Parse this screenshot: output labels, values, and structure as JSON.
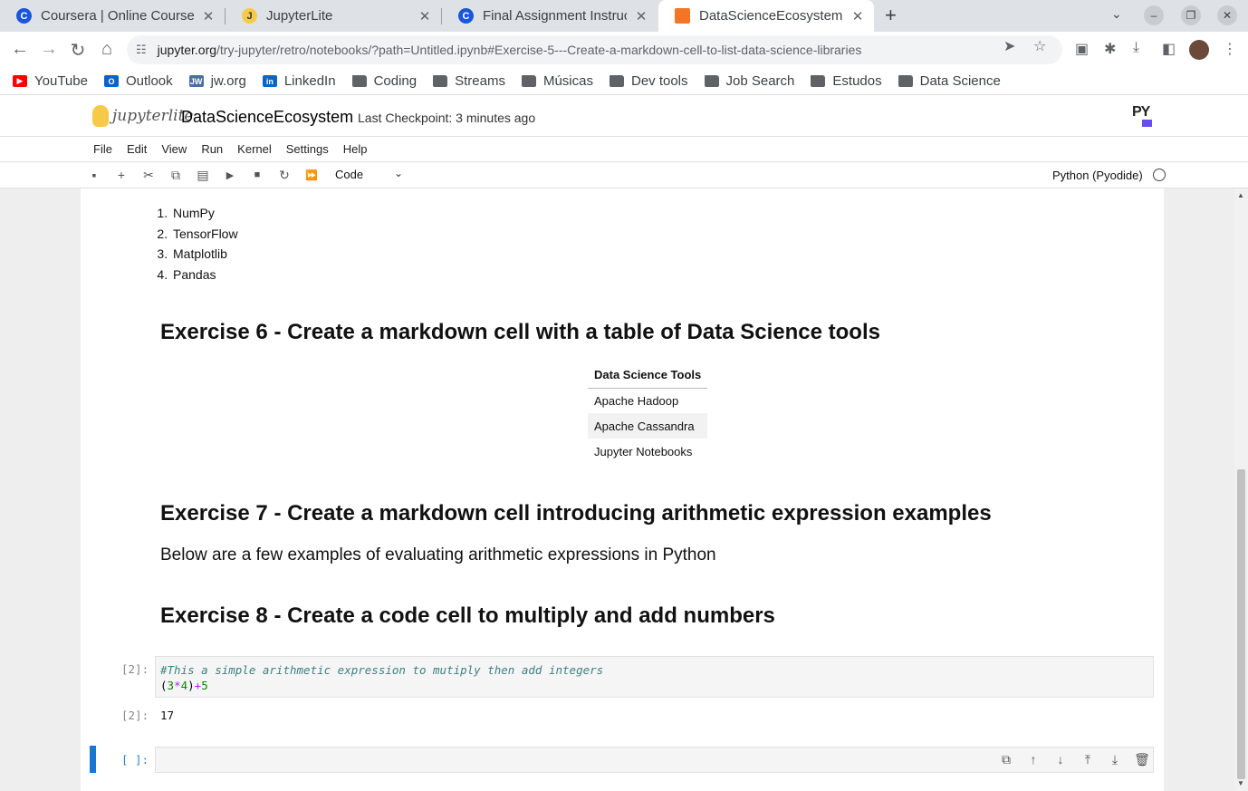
{
  "browser": {
    "tabs": [
      {
        "title": "Coursera | Online Courses",
        "favicon": "coursera-icon",
        "close": "✕"
      },
      {
        "title": "JupyterLite",
        "favicon": "jupyterlite-icon",
        "close": "✕"
      },
      {
        "title": "Final Assignment Instructi",
        "favicon": "coursera-icon",
        "close": "✕"
      },
      {
        "title": "DataScienceEcosystem",
        "favicon": "notebook-icon",
        "close": "✕"
      }
    ],
    "url_domain": "jupyter.org",
    "url_path": "/try-jupyter/retro/notebooks/?path=Untitled.ipynb#Exercise-5---Create-a-markdown-cell-to-list-data-science-libraries",
    "bookmarks": [
      {
        "label": "YouTube",
        "icon": "youtube-icon",
        "color": "#ff0000"
      },
      {
        "label": "Outlook",
        "icon": "outlook-icon",
        "color": "#0a64c8"
      },
      {
        "label": "jw.org",
        "icon": "jw-icon",
        "color": "#4a6da7"
      },
      {
        "label": "LinkedIn",
        "icon": "linkedin-icon",
        "color": "#0a66c2"
      },
      {
        "label": "Coding",
        "icon": "folder-icon"
      },
      {
        "label": "Streams",
        "icon": "folder-icon"
      },
      {
        "label": "Músicas",
        "icon": "folder-icon"
      },
      {
        "label": "Dev tools",
        "icon": "folder-icon"
      },
      {
        "label": "Job Search",
        "icon": "folder-icon"
      },
      {
        "label": "Estudos",
        "icon": "folder-icon"
      },
      {
        "label": "Data Science",
        "icon": "folder-icon"
      }
    ]
  },
  "jupyter": {
    "logo_text": "jupyterlite",
    "notebook_title": "DataScienceEcosystem",
    "checkpoint": "Last Checkpoint: 3 minutes ago",
    "menu": [
      "File",
      "Edit",
      "View",
      "Run",
      "Kernel",
      "Settings",
      "Help"
    ],
    "cell_type": "Code",
    "kernel": "Python (Pyodide)",
    "py_logo": "PY"
  },
  "notebook": {
    "libraries": [
      "NumPy",
      "TensorFlow",
      "Matplotlib",
      "Pandas"
    ],
    "ex6_heading": "Exercise 6 - Create a markdown cell with a table of Data Science tools",
    "tools_header": "Data Science Tools",
    "tools": [
      "Apache Hadoop",
      "Apache Cassandra",
      "Jupyter Notebooks"
    ],
    "ex7_heading": "Exercise 7 - Create a markdown cell introducing arithmetic expression examples",
    "ex7_text": "Below are a few examples of evaluating arithmetic expressions in Python",
    "ex8_heading": "Exercise 8 - Create a code cell to multiply and add numbers",
    "code_prompt": "[2]:",
    "code_comment": "#This a simple arithmetic expression to mutiply then add integers",
    "output_prompt": "[2]:",
    "output_value": "17",
    "empty_prompt": "[ ]:"
  }
}
